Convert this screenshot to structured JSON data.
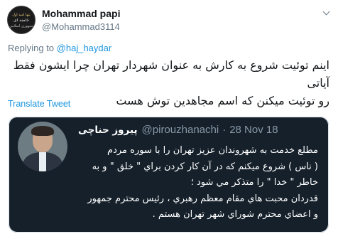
{
  "author": {
    "name": "Mohammad papi",
    "handle": "@Mohammad3114",
    "avatar_lines": [
      "تنها امید اول",
      "خامنه ای",
      "جمهوری اسلامی"
    ]
  },
  "reply": {
    "prefix": "Replying to",
    "to": "@haj_haydar"
  },
  "tweet": {
    "text_lines": [
      "اینم توئیت شروع به کارش به عنوان شهردار تهران چرا ایشون فقط آیاتی",
      "رو توئیت میکنن که اسم مجاهدین توش هست"
    ]
  },
  "translate_label": "Translate Tweet",
  "quoted": {
    "name": "پیروز حناچی",
    "handle": "@pirouzhanachi",
    "sep": "·",
    "date": "28 Nov 18",
    "lines": [
      "مطلع خدمت به شهروندان عزيز تهران را با سوره مردم",
      "( ناس ) شروع ميکنم که در آن کار کردن براي \" خلق \" و به",
      "خاطر \" خدا \" را متذکر مي شود ؛",
      "قدردان محبت هاي مقام معظم رهبري ، رئيس محترم جمهور",
      "و اعضاي محترم شوراي شهر تهران هستم ."
    ]
  },
  "icons": {
    "menu": "chevron-down-icon"
  },
  "colors": {
    "link": "#1b95e0",
    "card_bg": "#15202b",
    "muted": "#657786"
  }
}
